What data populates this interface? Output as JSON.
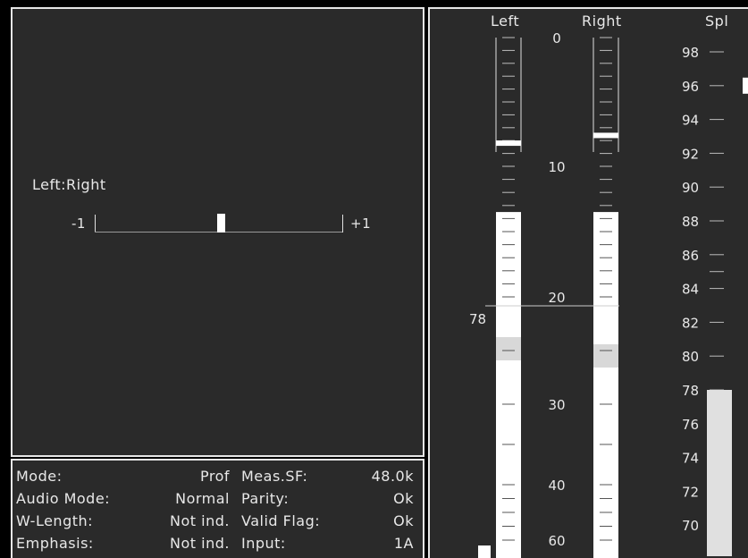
{
  "balance": {
    "title": "Left:Right",
    "min_label": "-1",
    "max_label": "+1",
    "value": 0.02
  },
  "status": {
    "rows": [
      {
        "k1": "Mode:",
        "v1": "Prof",
        "k2": "Meas.SF:",
        "v2": "48.0k"
      },
      {
        "k1": "Audio Mode:",
        "v1": "Normal",
        "k2": "Parity:",
        "v2": "Ok"
      },
      {
        "k1": "W-Length:",
        "v1": "Not ind.",
        "k2": "Valid Flag:",
        "v2": "Ok"
      },
      {
        "k1": "Emphasis:",
        "v1": "Not ind.",
        "k2": "Input:",
        "v2": "1A"
      }
    ]
  },
  "meters": {
    "left_label": "Left",
    "right_label": "Right",
    "spl_label": "Spl",
    "scale_labels": [
      "0",
      "10",
      "20",
      "30",
      "40",
      "60"
    ],
    "reference_label": "78",
    "left_peak_hold": 8.2,
    "right_peak_hold": 7.6,
    "left_level": 13.5,
    "right_level": 13.5,
    "spl_labels": [
      "98",
      "96",
      "94",
      "92",
      "90",
      "88",
      "86",
      "84",
      "82",
      "80",
      "78",
      "76",
      "74",
      "72",
      "70"
    ],
    "spl_value": 78,
    "spl_marker": 96
  }
}
